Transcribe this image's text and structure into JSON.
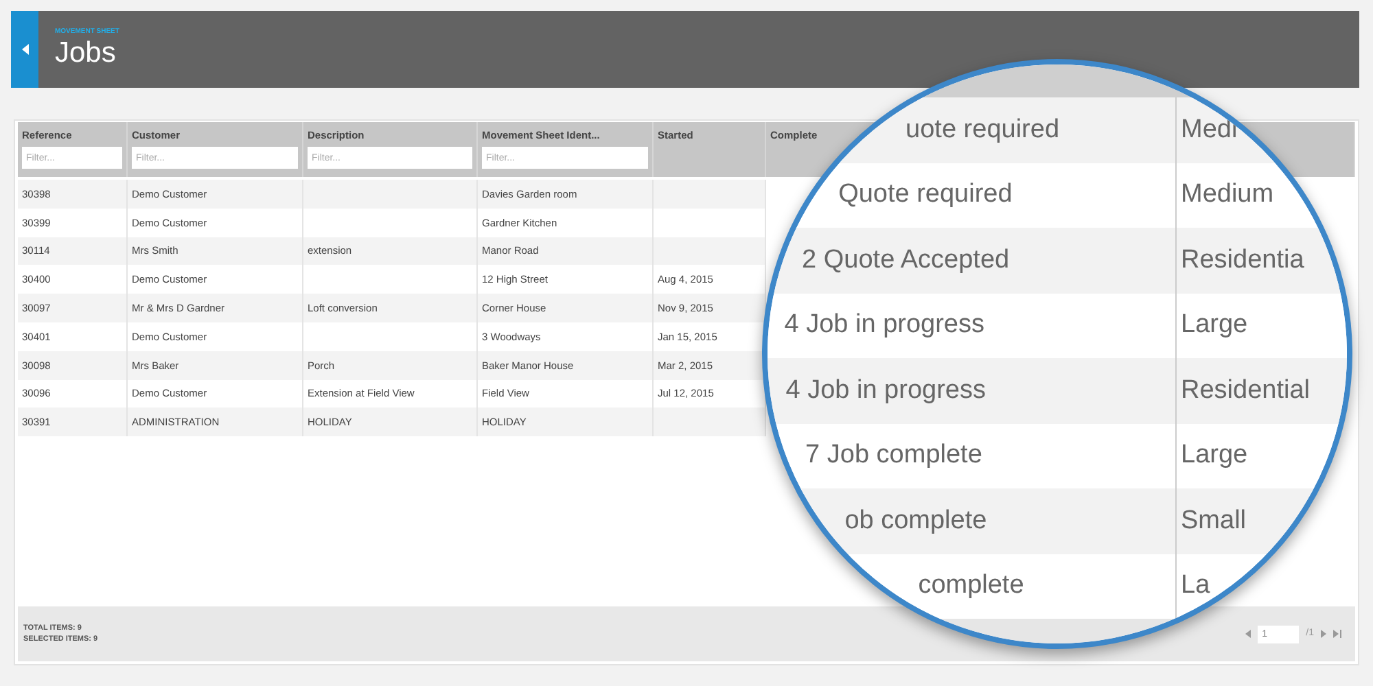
{
  "header": {
    "breadcrumb": "MOVEMENT SHEET",
    "title": "Jobs"
  },
  "table": {
    "columns": [
      {
        "label": "Reference",
        "placeholder": "Filter..."
      },
      {
        "label": "Customer",
        "placeholder": "Filter..."
      },
      {
        "label": "Description",
        "placeholder": "Filter..."
      },
      {
        "label": "Movement Sheet Ident...",
        "placeholder": "Filter..."
      },
      {
        "label": "Started"
      },
      {
        "label": "Complete"
      }
    ],
    "rows": [
      {
        "cells": [
          "30398",
          "Demo Customer",
          "",
          "Davies Garden room",
          ""
        ]
      },
      {
        "cells": [
          "30399",
          "Demo Customer",
          "",
          "Gardner Kitchen",
          ""
        ]
      },
      {
        "cells": [
          "30114",
          "Mrs Smith",
          "extension",
          "Manor Road",
          ""
        ]
      },
      {
        "cells": [
          "30400",
          "Demo Customer",
          "",
          "12 High Street",
          "Aug 4, 2015"
        ]
      },
      {
        "cells": [
          "30097",
          "Mr & Mrs D Gardner",
          "Loft conversion",
          "Corner House",
          "Nov 9, 2015"
        ]
      },
      {
        "cells": [
          "30401",
          "Demo Customer",
          "",
          "3 Woodways",
          "Jan 15, 2015"
        ]
      },
      {
        "cells": [
          "30098",
          "Mrs Baker",
          "Porch",
          "Baker Manor House",
          "Mar 2, 2015"
        ]
      },
      {
        "cells": [
          "30096",
          "Demo Customer",
          "Extension at Field View",
          "Field View",
          "Jul 12, 2015"
        ]
      },
      {
        "cells": [
          "30391",
          "ADMINISTRATION",
          "HOLIDAY",
          "HOLIDAY",
          ""
        ]
      }
    ]
  },
  "footer": {
    "total": "TOTAL ITEMS: 9",
    "selected": "SELECTED ITEMS: 9"
  },
  "pagination": {
    "page": "1",
    "of": "/1"
  },
  "magnifier": {
    "rows": [
      {
        "status": "uote required",
        "size": "Medi"
      },
      {
        "status": "Quote required",
        "size": "Medium"
      },
      {
        "status": "2 Quote Accepted",
        "size": "Residentia"
      },
      {
        "status": "4 Job in progress",
        "size": "Large"
      },
      {
        "status": "4 Job in progress",
        "size": "Residential"
      },
      {
        "status": "7 Job complete",
        "size": "Large"
      },
      {
        "status": "ob complete",
        "size": "Small"
      },
      {
        "status": "complete",
        "size": "La"
      }
    ]
  }
}
